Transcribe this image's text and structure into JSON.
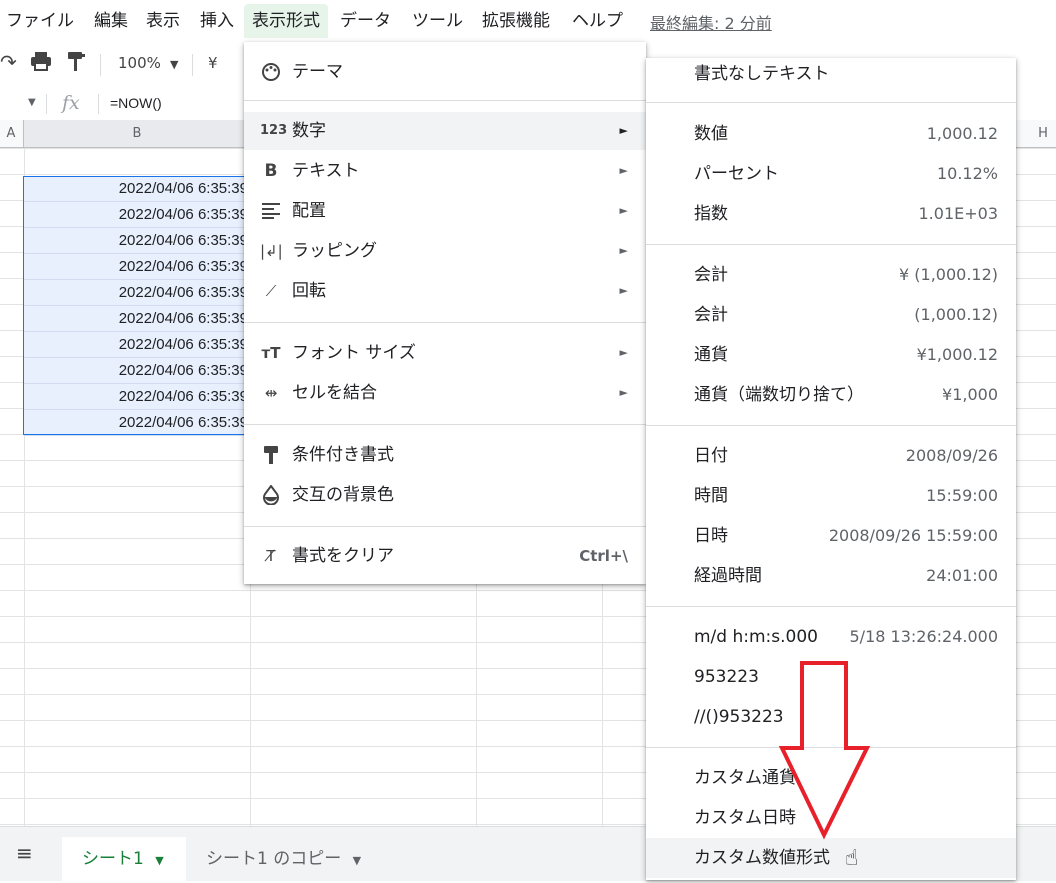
{
  "menubar": {
    "items": [
      "ファイル",
      "編集",
      "表示",
      "挿入",
      "表示形式",
      "データ",
      "ツール",
      "拡張機能",
      "ヘルプ"
    ],
    "last_edit": "最終編集: 2 分前"
  },
  "toolbar": {
    "zoom": "100%",
    "currency": "¥"
  },
  "formula_bar": {
    "fx": "fx",
    "formula": "=NOW()"
  },
  "grid": {
    "col_a": "A",
    "col_b": "B",
    "col_h": "H",
    "cells": [
      "2022/04/06 6:35:39",
      "2022/04/06 6:35:39",
      "2022/04/06 6:35:39",
      "2022/04/06 6:35:39",
      "2022/04/06 6:35:39",
      "2022/04/06 6:35:39",
      "2022/04/06 6:35:39",
      "2022/04/06 6:35:39",
      "2022/04/06 6:35:39",
      "2022/04/06 6:35:39"
    ]
  },
  "format_menu": {
    "items": [
      {
        "label": "テーマ",
        "icon": "palette-icon"
      },
      {
        "label": "数字",
        "icon": "number-123-icon"
      },
      {
        "label": "テキスト",
        "icon": "bold-icon"
      },
      {
        "label": "配置",
        "icon": "align-icon"
      },
      {
        "label": "ラッピング",
        "icon": "wrap-icon"
      },
      {
        "label": "回転",
        "icon": "rotate-icon"
      },
      {
        "label": "フォント サイズ",
        "icon": "font-size-icon"
      },
      {
        "label": "セルを結合",
        "icon": "merge-icon"
      },
      {
        "label": "条件付き書式",
        "icon": "paint-roller-icon"
      },
      {
        "label": "交互の背景色",
        "icon": "drop-icon"
      },
      {
        "label": "書式をクリア",
        "icon": "clear-format-icon",
        "shortcut": "Ctrl+\\"
      }
    ],
    "arrow": "►"
  },
  "number_submenu": {
    "plain": "書式なしテキスト",
    "items": [
      {
        "label": "数値",
        "example": "1,000.12"
      },
      {
        "label": "パーセント",
        "example": "10.12%"
      },
      {
        "label": "指数",
        "example": "1.01E+03"
      },
      {
        "label": "会計",
        "example": "¥ (1,000.12)"
      },
      {
        "label": "会計",
        "example": "(1,000.12)"
      },
      {
        "label": "通貨",
        "example": "¥1,000.12"
      },
      {
        "label": "通貨（端数切り捨て）",
        "example": "¥1,000"
      },
      {
        "label": "日付",
        "example": "2008/09/26"
      },
      {
        "label": "時間",
        "example": "15:59:00"
      },
      {
        "label": "日時",
        "example": "2008/09/26 15:59:00"
      },
      {
        "label": "経過時間",
        "example": "24:01:00"
      },
      {
        "label": "m/d h:m:s.000",
        "example": "5/18 13:26:24.000"
      },
      {
        "label": "953223",
        "example": ""
      },
      {
        "label": "//()953223",
        "example": ""
      },
      {
        "label": "カスタム通貨",
        "example": ""
      },
      {
        "label": "カスタム日時",
        "example": ""
      },
      {
        "label": "カスタム数値形式",
        "example": ""
      }
    ]
  },
  "sheets": {
    "tab1": "シート1",
    "tab2": "シート1 のコピー"
  },
  "colors": {
    "accent_green": "#188038",
    "selection": "#e8f0fe",
    "arrow_red": "#e8202a"
  }
}
